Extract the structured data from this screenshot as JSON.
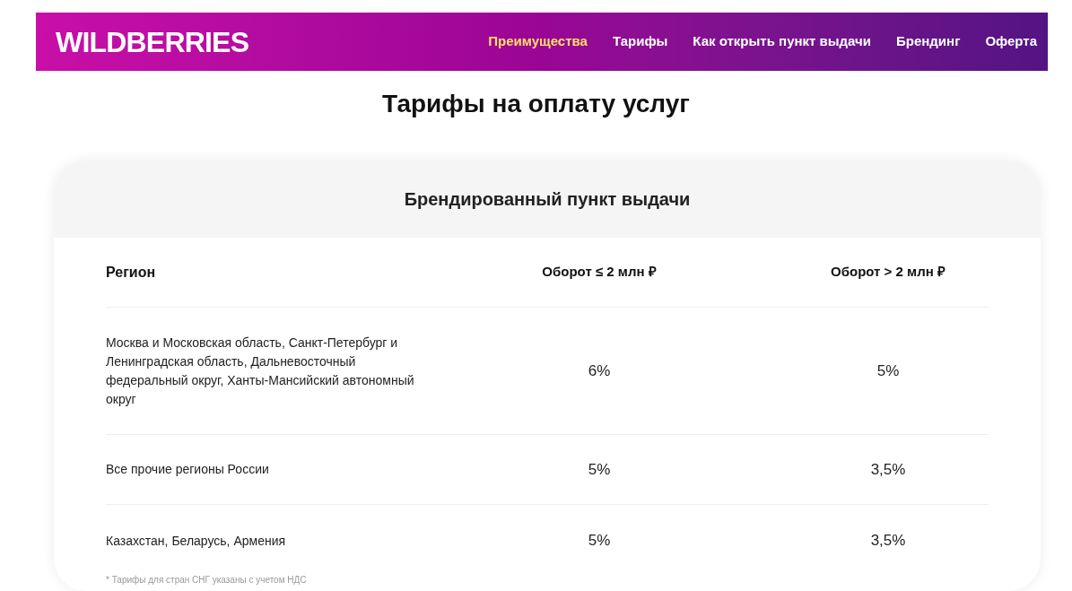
{
  "header": {
    "logo": "WILDBERRIES",
    "nav": [
      {
        "label": "Преимущества",
        "selected": true
      },
      {
        "label": "Тарифы",
        "selected": false
      },
      {
        "label": "Как открыть пункт выдачи",
        "selected": false
      },
      {
        "label": "Брендинг",
        "selected": false
      },
      {
        "label": "Оферта",
        "selected": false
      }
    ]
  },
  "page_title": "Тарифы на оплату услуг",
  "card": {
    "title": "Брендированный пункт выдачи",
    "table": {
      "columns": [
        "Регион",
        "Оборот ≤ 2 млн ₽",
        "Оборот > 2 млн ₽"
      ],
      "rows": [
        [
          "Москва и Московская область, Санкт-Петербург и Ленинградская область, Дальневосточный федеральный округ, Ханты-Мансийский автономный округ",
          "6%",
          "5%"
        ],
        [
          "Все прочие регионы России",
          "5%",
          "3,5%"
        ],
        [
          "Казахстан, Беларусь, Армения",
          "5%",
          "3,5%"
        ]
      ]
    },
    "footnote": "* Тарифы для стран СНГ указаны с учетом НДС"
  }
}
